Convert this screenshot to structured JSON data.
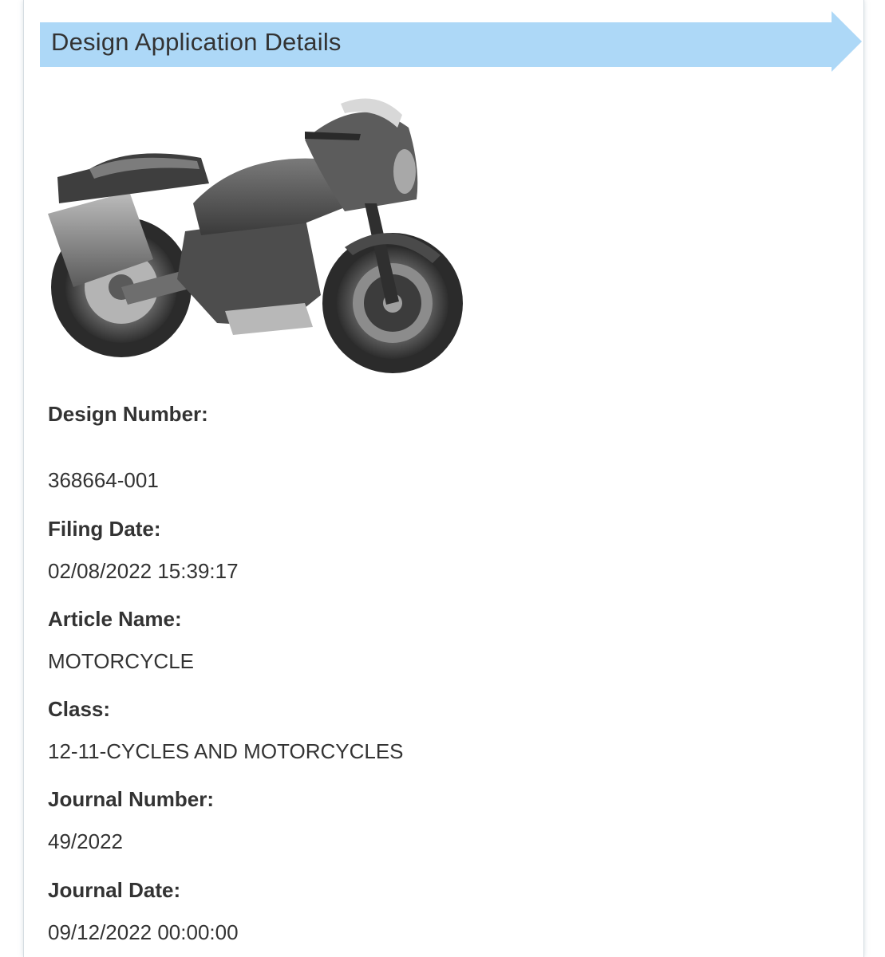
{
  "header": {
    "title": "Design Application Details",
    "banner_color": "#add8f7"
  },
  "image": {
    "icon": "motorcycle-design-image"
  },
  "fields": [
    {
      "label": "Design Number:",
      "value": "368664-001"
    },
    {
      "label": "Filing Date:",
      "value": "02/08/2022 15:39:17"
    },
    {
      "label": "Article Name:",
      "value": "MOTORCYCLE"
    },
    {
      "label": "Class:",
      "value": "12-11-CYCLES AND MOTORCYCLES"
    },
    {
      "label": "Journal Number:",
      "value": "49/2022"
    },
    {
      "label": "Journal Date:",
      "value": "09/12/2022 00:00:00"
    }
  ]
}
